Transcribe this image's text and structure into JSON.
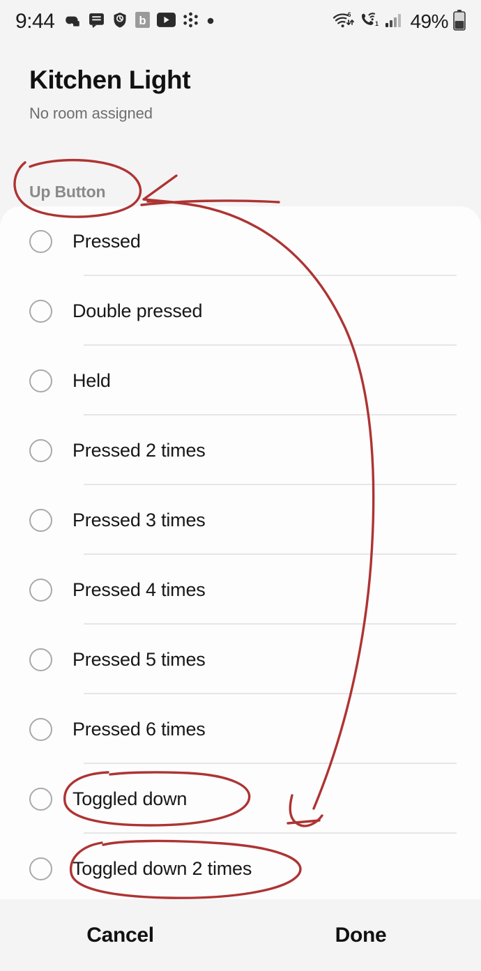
{
  "status_bar": {
    "clock": "9:44",
    "left_icons": [
      {
        "name": "game-controller-icon",
        "glyph": "•"
      },
      {
        "name": "message-icon",
        "glyph": "•"
      },
      {
        "name": "shield-check-icon",
        "glyph": "•"
      },
      {
        "name": "bitwarden-b-icon",
        "glyph": "b"
      },
      {
        "name": "youtube-play-icon",
        "glyph": "▶"
      },
      {
        "name": "share-nodes-icon",
        "glyph": "•"
      },
      {
        "name": "dot-icon",
        "glyph": "•"
      }
    ],
    "right_icons": [
      {
        "name": "wifi-icon",
        "badge": "6"
      },
      {
        "name": "wifi-calling-icon",
        "badge": "1"
      },
      {
        "name": "cellular-signal-icon",
        "badge": ""
      }
    ],
    "battery_percent": "49%"
  },
  "header": {
    "title": "Kitchen Light",
    "subtitle": "No room assigned"
  },
  "section": {
    "label": "Up Button"
  },
  "options": [
    {
      "label": "Pressed",
      "selected": false
    },
    {
      "label": "Double pressed",
      "selected": false
    },
    {
      "label": "Held",
      "selected": false
    },
    {
      "label": "Pressed 2 times",
      "selected": false
    },
    {
      "label": "Pressed 3 times",
      "selected": false
    },
    {
      "label": "Pressed 4 times",
      "selected": false
    },
    {
      "label": "Pressed 5 times",
      "selected": false
    },
    {
      "label": "Pressed 6 times",
      "selected": false
    },
    {
      "label": "Toggled down",
      "selected": false
    },
    {
      "label": "Toggled down 2 times",
      "selected": false
    }
  ],
  "bottom_bar": {
    "cancel_label": "Cancel",
    "done_label": "Done"
  },
  "annotation": {
    "color": "#ad3433",
    "marks": [
      {
        "name": "circle-up-button",
        "shape": "ellipse",
        "target": "Up Button"
      },
      {
        "name": "arrow-to-up-button",
        "shape": "arrow",
        "target": "Up Button"
      },
      {
        "name": "long-curved-arrow",
        "shape": "curve-arrow",
        "from": "Up Button",
        "to": "Toggled down"
      },
      {
        "name": "circle-toggled-down",
        "shape": "ellipse",
        "target": "Toggled down"
      },
      {
        "name": "circle-toggled-down-2-times",
        "shape": "ellipse",
        "target": "Toggled down 2 times"
      }
    ]
  },
  "colors": {
    "background": "#f4f4f4",
    "sheet": "#fdfdfd",
    "divider": "#e6e6e6",
    "text_primary": "#171717",
    "text_secondary": "#6e6e6e",
    "label_gray": "#8a8a8a",
    "annotation_red": "#ad3433"
  }
}
